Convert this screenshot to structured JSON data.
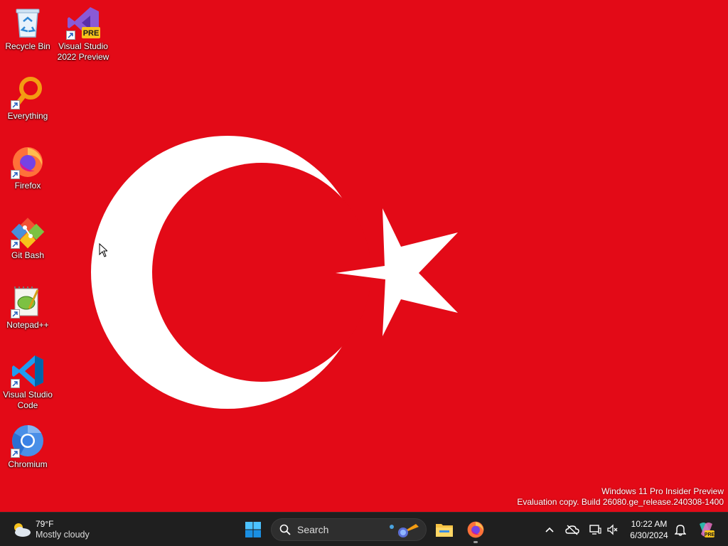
{
  "desktop": {
    "icons": [
      {
        "label": "Recycle Bin",
        "icon": "recycle-bin-icon"
      },
      {
        "label": "Visual Studio\n2022 Preview",
        "icon": "visual-studio-preview-icon",
        "badge": "PRE"
      },
      {
        "label": "Everything",
        "icon": "everything-search-icon"
      },
      {
        "label": "Firefox",
        "icon": "firefox-icon"
      },
      {
        "label": "Git Bash",
        "icon": "git-bash-icon"
      },
      {
        "label": "Notepad++",
        "icon": "notepad-plus-plus-icon"
      },
      {
        "label": "Visual Studio\nCode",
        "icon": "vscode-icon"
      },
      {
        "label": "Chromium",
        "icon": "chromium-icon"
      }
    ],
    "watermark": {
      "line1": "Windows 11 Pro Insider Preview",
      "line2": "Evaluation copy. Build 26080.ge_release.240308-1400"
    },
    "wallpaper": {
      "background": "#e30a17",
      "foreground": "#ffffff"
    }
  },
  "taskbar": {
    "weather": {
      "temp": "79°F",
      "condition": "Mostly cloudy"
    },
    "search": {
      "placeholder": "Search"
    },
    "clock": {
      "time": "10:22 AM",
      "date": "6/30/2024"
    },
    "copilot_badge": "PRE",
    "background": "#1f1f1f"
  }
}
